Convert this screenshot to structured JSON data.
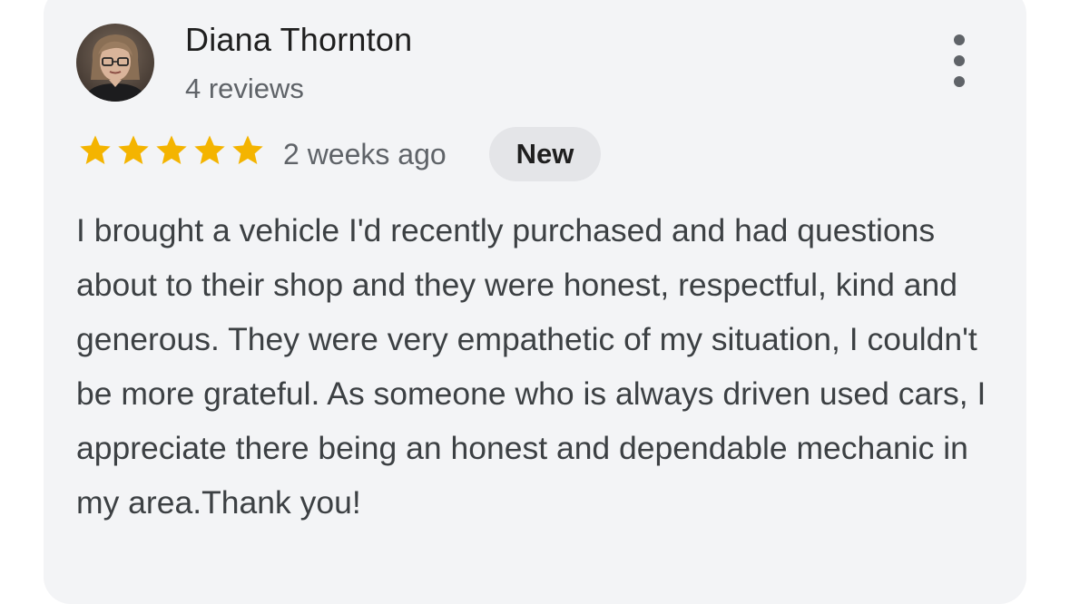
{
  "review": {
    "author_name": "Diana Thornton",
    "review_count": "4 reviews",
    "rating": 5,
    "rating_max": 5,
    "timestamp": "2 weeks ago",
    "badge": "New",
    "text": "I brought a vehicle I'd recently purchased and had questions about to their shop and they were honest, respectful, kind and generous. They were very empathetic of my situation, I couldn't be more grateful. As someone who is always driven used cars, I appreciate there being an honest and dependable mechanic in my area.Thank you!"
  },
  "icons": {
    "menu": "more-vert-icon",
    "rating": "star-icon"
  },
  "colors": {
    "card_background": "#f3f4f6",
    "star": "#f4b400",
    "badge_background": "#e4e5e8",
    "primary_text": "#1f1f1f",
    "secondary_text": "#5f6368"
  }
}
